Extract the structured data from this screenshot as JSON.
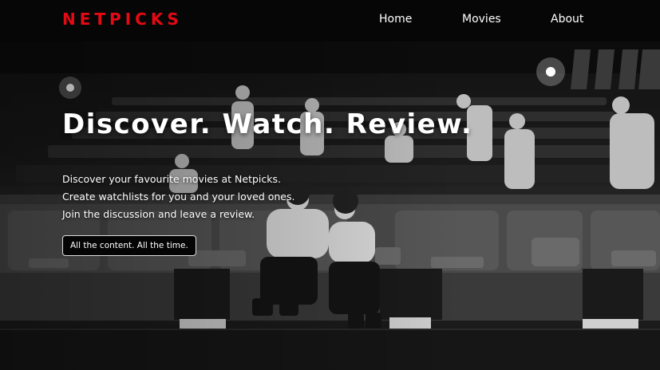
{
  "navbar": {
    "logo": "NETPICKS",
    "links": [
      "Home",
      "Movies",
      "About"
    ],
    "logo_color": "#e50914"
  },
  "hero": {
    "headline": "Discover. Watch. Review.",
    "lines": [
      "Discover your favourite movies at Netpicks.",
      "Create watchlists for you and your loved ones.",
      "Join the discussion and leave a review."
    ],
    "cta_label": "All the content. All the time."
  }
}
